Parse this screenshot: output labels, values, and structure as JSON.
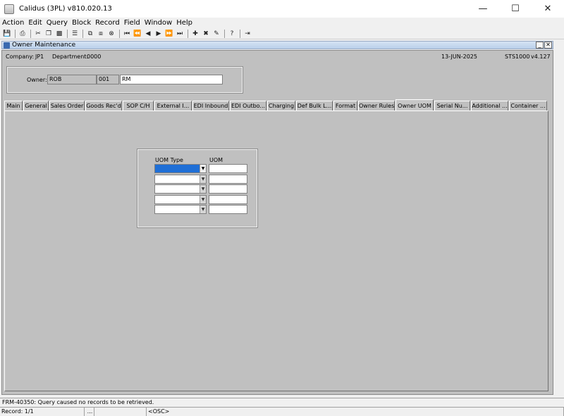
{
  "window": {
    "title": "Calidus (3PL) v810.020.13"
  },
  "menu": [
    "Action",
    "Edit",
    "Query",
    "Block",
    "Record",
    "Field",
    "Window",
    "Help"
  ],
  "toolbar": {
    "groups": [
      [
        "save-icon"
      ],
      [
        "print-icon"
      ],
      [
        "cut-icon",
        "copy-icon",
        "paste-icon"
      ],
      [
        "list-icon"
      ],
      [
        "copy-record-icon",
        "paste-record-icon",
        "clear-record-icon"
      ],
      [
        "first-record-icon",
        "previous-set-icon",
        "previous-record-icon",
        "next-record-icon",
        "next-set-icon",
        "last-record-icon"
      ],
      [
        "insert-record-icon",
        "delete-record-icon",
        "clear-icon"
      ],
      [
        "help-icon"
      ],
      [
        "exit-icon"
      ]
    ]
  },
  "form": {
    "title": "Owner Maintenance",
    "company_label": "Company:",
    "company_value": "JP1",
    "department_label": "Department:",
    "department_value": "0000",
    "date": "13-JUN-2025",
    "screen_id": "STS1000",
    "version": "v4.127"
  },
  "owner": {
    "label": "Owner:",
    "code": "ROB",
    "number": "001",
    "name": "RM"
  },
  "tabs": [
    {
      "label": "Main",
      "active": false
    },
    {
      "label": "General",
      "active": false
    },
    {
      "label": "Sales Order",
      "active": false
    },
    {
      "label": "Goods Rec'd",
      "active": false
    },
    {
      "label": "SOP C/H",
      "active": false
    },
    {
      "label": "External I...",
      "active": false
    },
    {
      "label": "EDI Inbound",
      "active": false
    },
    {
      "label": "EDI Outbo...",
      "active": false
    },
    {
      "label": "Charging",
      "active": false
    },
    {
      "label": "Def Bulk L...",
      "active": false
    },
    {
      "label": "Format",
      "active": false
    },
    {
      "label": "Owner Rules",
      "active": false
    },
    {
      "label": "Owner UOM",
      "active": true
    },
    {
      "label": "Serial Nu...",
      "active": false
    },
    {
      "label": "Additional ...",
      "active": false
    },
    {
      "label": "Container ...",
      "active": false
    }
  ],
  "uom_grid": {
    "col_type": "UOM Type",
    "col_uom": "UOM",
    "rows": [
      {
        "type": "",
        "uom": ""
      },
      {
        "type": "",
        "uom": ""
      },
      {
        "type": "",
        "uom": ""
      },
      {
        "type": "",
        "uom": ""
      },
      {
        "type": "",
        "uom": ""
      }
    ]
  },
  "status": {
    "message": "FRM-40350: Query caused no records to be retrieved.",
    "record": "Record: 1/1",
    "ellipsis": "...",
    "mode": "<OSC>"
  },
  "colors": {
    "form_background": "#c0c0c0",
    "selection": "#1f6fd6",
    "form_title_bg": "#c8d9ef"
  }
}
